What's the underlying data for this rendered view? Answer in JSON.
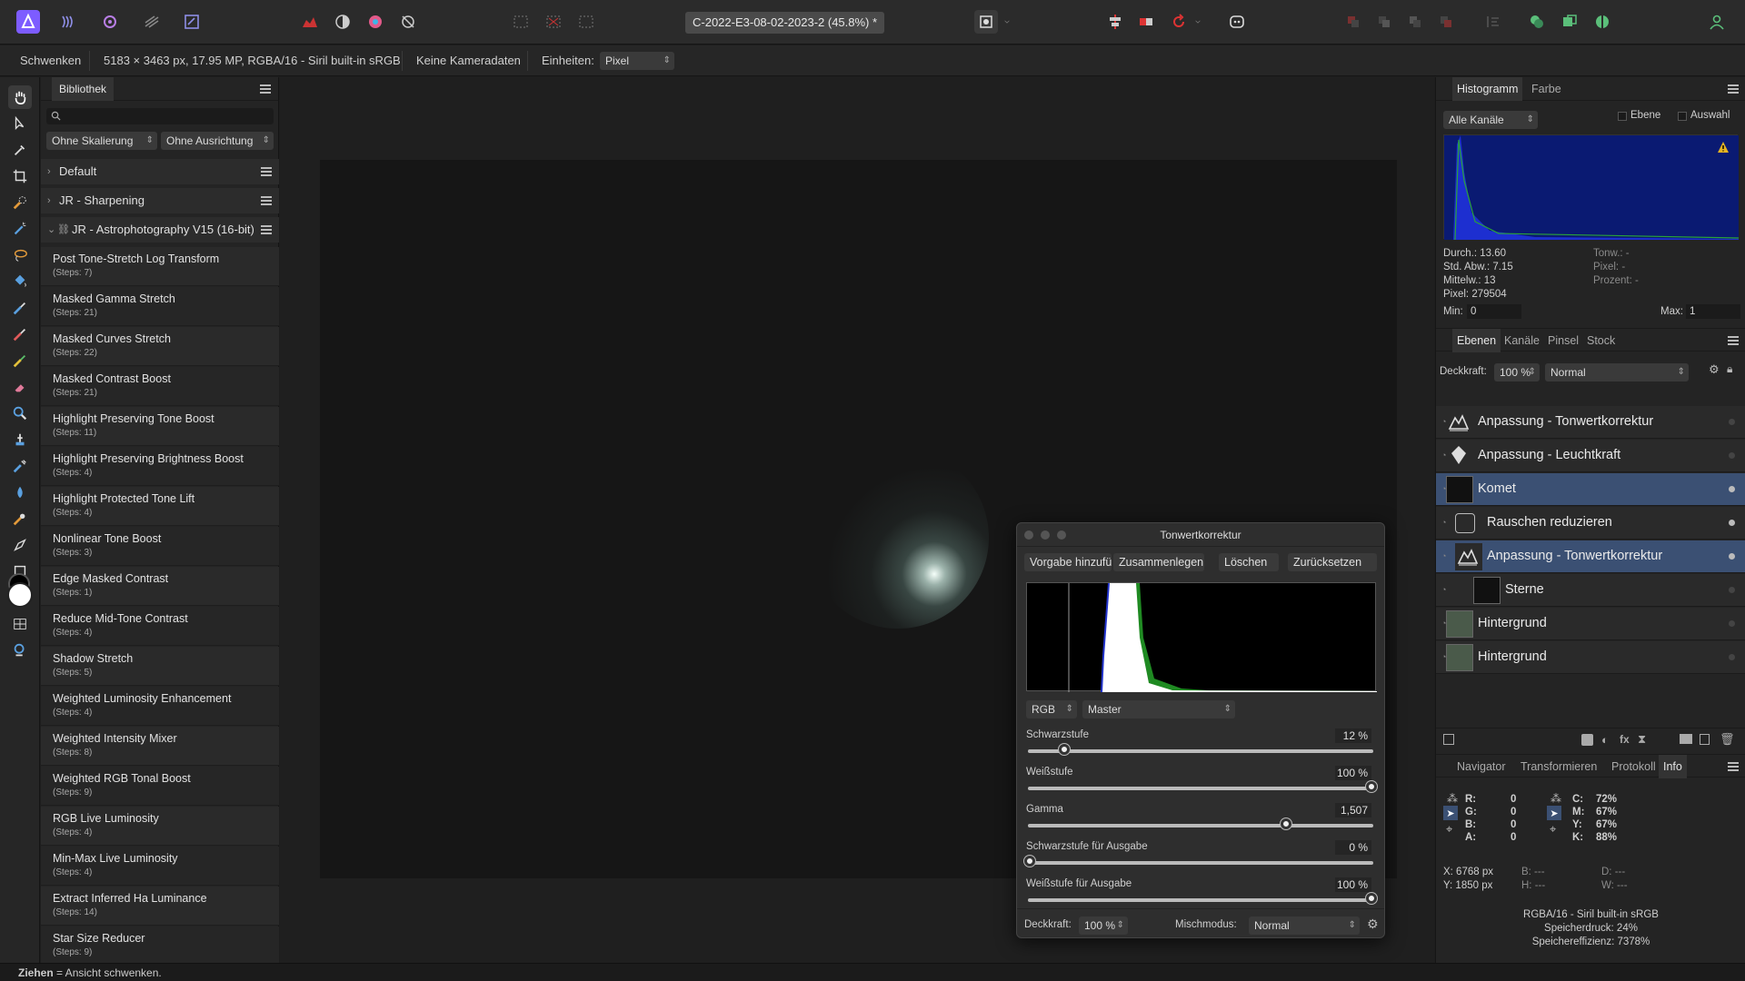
{
  "toolbar": {
    "document_title": "C-2022-E3-08-02-2023-2 (45.8%) *"
  },
  "context_bar": {
    "tool_name": "Schwenken",
    "image_info": "5183 × 3463 px, 17.95 MP, RGBA/16 - Siril built-in sRGB",
    "camera_data": "Keine Kameradaten",
    "units_label": "Einheiten:",
    "units_value": "Pixel"
  },
  "library": {
    "tab": "Bibliothek",
    "scaling_select": "Ohne Skalierung",
    "alignment_select": "Ohne Ausrichtung",
    "groups": [
      {
        "name": "Default"
      },
      {
        "name": "JR - Sharpening"
      },
      {
        "name": "JR - Astrophotography V15 (16-bit)"
      }
    ],
    "macros": [
      {
        "name": "Post Tone-Stretch Log Transform",
        "steps": "(Steps: 7)"
      },
      {
        "name": "Masked Gamma Stretch",
        "steps": "(Steps: 21)"
      },
      {
        "name": "Masked Curves Stretch",
        "steps": "(Steps: 22)"
      },
      {
        "name": "Masked Contrast Boost",
        "steps": "(Steps: 21)"
      },
      {
        "name": "Highlight Preserving Tone Boost",
        "steps": "(Steps: 11)"
      },
      {
        "name": "Highlight Preserving Brightness Boost",
        "steps": "(Steps: 4)"
      },
      {
        "name": "Highlight Protected Tone Lift",
        "steps": "(Steps: 4)"
      },
      {
        "name": "Nonlinear Tone Boost",
        "steps": "(Steps: 3)"
      },
      {
        "name": "Edge Masked Contrast",
        "steps": "(Steps: 1)"
      },
      {
        "name": "Reduce Mid-Tone Contrast",
        "steps": "(Steps: 4)"
      },
      {
        "name": "Shadow Stretch",
        "steps": "(Steps: 5)"
      },
      {
        "name": "Weighted Luminosity Enhancement",
        "steps": "(Steps: 4)"
      },
      {
        "name": "Weighted Intensity Mixer",
        "steps": "(Steps: 8)"
      },
      {
        "name": "Weighted RGB Tonal Boost",
        "steps": "(Steps: 9)"
      },
      {
        "name": "RGB Live Luminosity",
        "steps": "(Steps: 4)"
      },
      {
        "name": "Min-Max Live Luminosity",
        "steps": "(Steps: 4)"
      },
      {
        "name": "Extract Inferred Ha Luminance",
        "steps": "(Steps: 14)"
      },
      {
        "name": "Star Size Reducer",
        "steps": "(Steps: 9)"
      }
    ]
  },
  "levels_dialog": {
    "title": "Tonwertkorrektur",
    "buttons": [
      "Vorgabe hinzufügen",
      "Zusammenlegen",
      "Löschen",
      "Zurücksetzen"
    ],
    "channel_select": "RGB",
    "mode_select": "Master",
    "sliders": [
      {
        "label": "Schwarzstufe",
        "value": "12 %",
        "position": 0.1
      },
      {
        "label": "Weißstufe",
        "value": "100 %",
        "position": 1.0
      },
      {
        "label": "Gamma",
        "value": "1,507",
        "position": 0.75
      },
      {
        "label": "Schwarzstufe für Ausgabe",
        "value": "0 %",
        "position": 0.0
      },
      {
        "label": "Weißstufe für Ausgabe",
        "value": "100 %",
        "position": 1.0
      }
    ],
    "opacity_label": "Deckkraft:",
    "opacity_value": "100 %",
    "blend_label": "Mischmodus:",
    "blend_value": "Normal"
  },
  "histogram_panel": {
    "tabs": [
      "Histogramm",
      "Farbe"
    ],
    "channels_select": "Alle Kanäle",
    "checkbox_layer": "Ebene",
    "checkbox_selection": "Auswahl",
    "stats_left": [
      "Durch.: 13.60",
      "Std. Abw.: 7.15",
      "Mittelw.: 13",
      "Pixel: 279504"
    ],
    "stats_right": [
      "Tonw.: -",
      "Pixel: -",
      "Prozent: -"
    ],
    "min_label": "Min:",
    "min_value": "0",
    "max_label": "Max:",
    "max_value": "1"
  },
  "layers_panel": {
    "tabs": [
      "Ebenen",
      "Kanäle",
      "Pinsel",
      "Stock"
    ],
    "opacity_label": "Deckkraft:",
    "opacity_value": "100 %",
    "blend_value": "Normal",
    "layers": [
      {
        "name": "Anpassung - Tonwertkorrektur",
        "selected": false,
        "visible": false
      },
      {
        "name": "Anpassung - Leuchtkraft",
        "selected": false,
        "visible": false
      },
      {
        "name": "Komet",
        "selected": true,
        "visible": true
      },
      {
        "name": "Rauschen reduzieren",
        "selected": false,
        "visible": true
      },
      {
        "name": "Anpassung - Tonwertkorrektur",
        "selected": true,
        "visible": true
      },
      {
        "name": "Sterne",
        "selected": false,
        "visible": false
      },
      {
        "name": "Hintergrund",
        "selected": false,
        "visible": false
      },
      {
        "name": "Hintergrund",
        "selected": false,
        "visible": false
      }
    ]
  },
  "info_panel": {
    "tabs": [
      "Navigator",
      "Transformieren",
      "Protokoll",
      "Info"
    ],
    "rgba": [
      {
        "label": "R:",
        "value": "0"
      },
      {
        "label": "G:",
        "value": "0"
      },
      {
        "label": "B:",
        "value": "0"
      },
      {
        "label": "A:",
        "value": "0"
      }
    ],
    "cmyk": [
      {
        "label": "C:",
        "value": "72%"
      },
      {
        "label": "M:",
        "value": "67%"
      },
      {
        "label": "Y:",
        "value": "67%"
      },
      {
        "label": "K:",
        "value": "88%"
      }
    ],
    "pos_x": "X: 6768 px",
    "pos_y": "Y: 1850 px",
    "b": "B: ---",
    "h": "H: ---",
    "d": "D: ---",
    "w": "W: ---",
    "footer": [
      "RGBA/16 - Siril built-in sRGB",
      "Speicherdruck: 24%",
      "Speichereffizienz: 7378%"
    ]
  },
  "status_bar": {
    "action": "Ziehen",
    "hint": " = Ansicht schwenken."
  }
}
